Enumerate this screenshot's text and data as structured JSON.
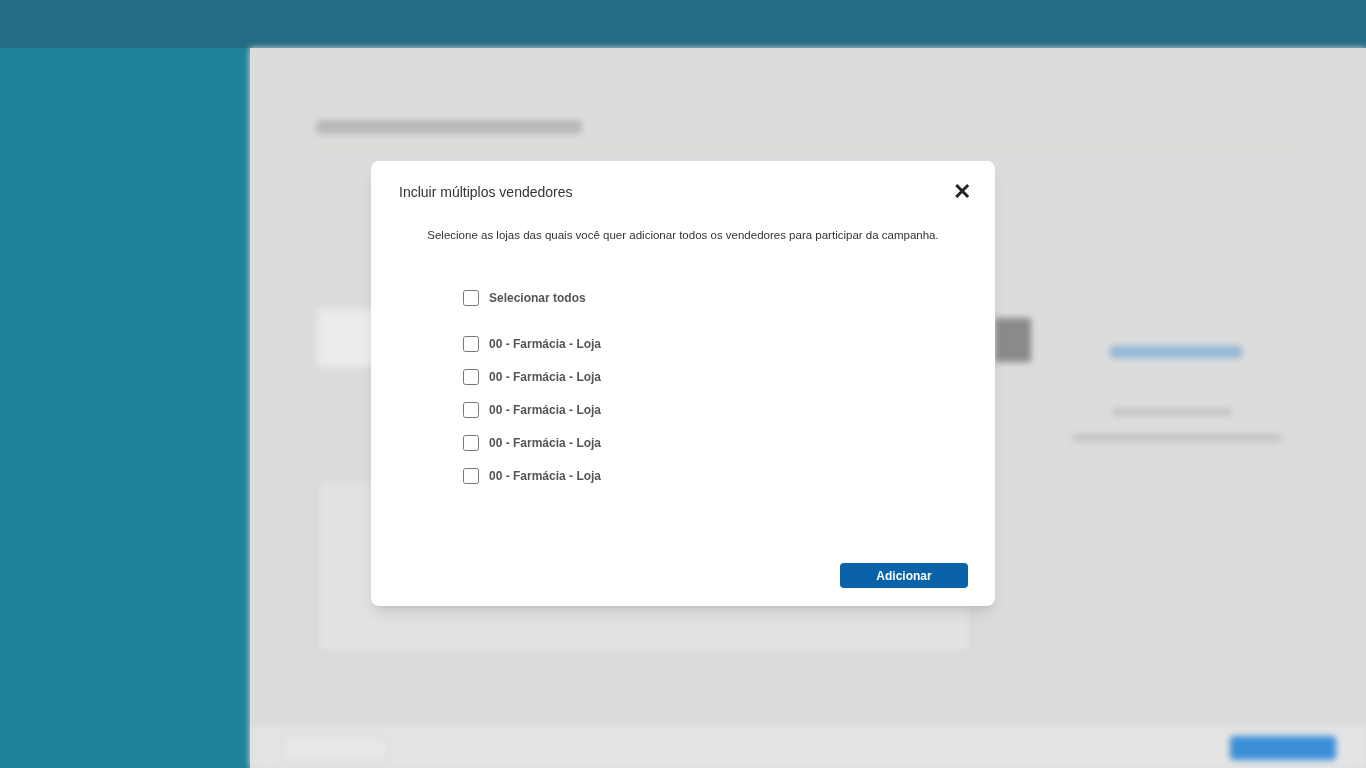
{
  "dialog": {
    "title": "Incluir múltiplos vendedores",
    "close": "✕",
    "description": "Selecione as lojas das quais você quer adicionar todos os vendedores para participar da campanha.",
    "select_all": {
      "label": "Selecionar todos",
      "checked": false
    },
    "stores": [
      {
        "label": "00 - Farmácia - Loja",
        "checked": false
      },
      {
        "label": "00 - Farmácia - Loja",
        "checked": false
      },
      {
        "label": "00 - Farmácia - Loja",
        "checked": false
      },
      {
        "label": "00 - Farmácia - Loja",
        "checked": false
      },
      {
        "label": "00 - Farmácia - Loja",
        "checked": false
      }
    ],
    "button": "Adicionar"
  }
}
